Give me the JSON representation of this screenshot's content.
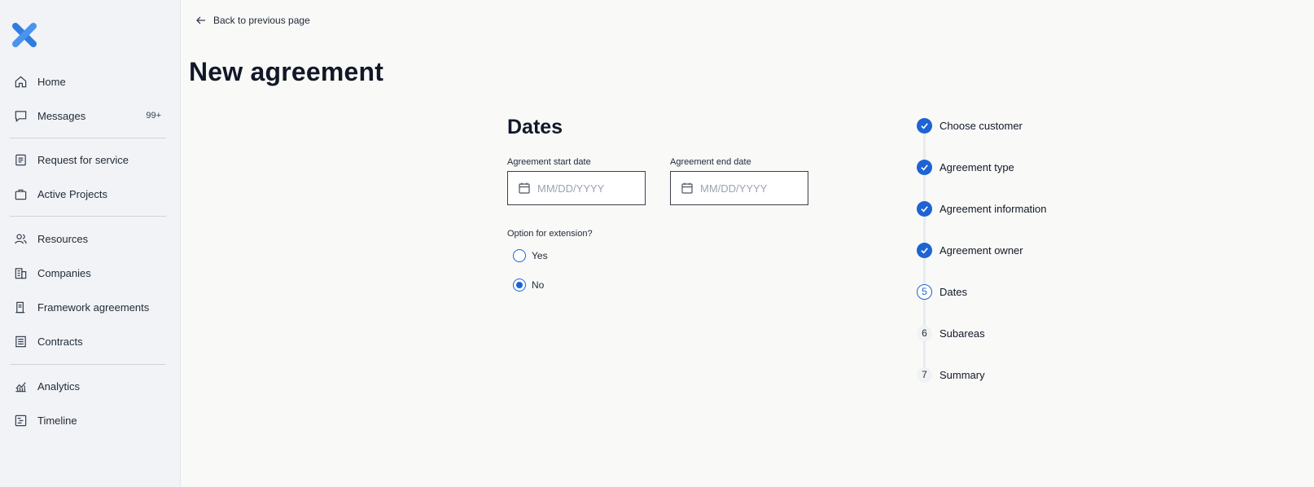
{
  "sidebar": {
    "items": [
      {
        "label": "Home",
        "icon": "home-icon"
      },
      {
        "label": "Messages",
        "icon": "chat-icon",
        "badge": "99+"
      },
      {
        "label": "Request for service",
        "icon": "list-document-icon"
      },
      {
        "label": "Active Projects",
        "icon": "briefcase-icon"
      },
      {
        "label": "Resources",
        "icon": "people-icon"
      },
      {
        "label": "Companies",
        "icon": "building-icon"
      },
      {
        "label": "Framework agreements",
        "icon": "document-icon"
      },
      {
        "label": "Contracts",
        "icon": "list-icon"
      },
      {
        "label": "Analytics",
        "icon": "chart-icon"
      },
      {
        "label": "Timeline",
        "icon": "timeline-icon"
      }
    ]
  },
  "header": {
    "back_label": "Back to previous page",
    "title": "New agreement"
  },
  "form": {
    "section_title": "Dates",
    "start_date": {
      "label": "Agreement start date",
      "placeholder": "MM/DD/YYYY",
      "value": ""
    },
    "end_date": {
      "label": "Agreement end date",
      "placeholder": "MM/DD/YYYY",
      "value": ""
    },
    "extension": {
      "label": "Option for extension?",
      "options": [
        "Yes",
        "No"
      ],
      "selected": "No"
    }
  },
  "stepper": {
    "steps": [
      {
        "number": "1",
        "label": "Choose customer",
        "status": "done"
      },
      {
        "number": "2",
        "label": "Agreement type",
        "status": "done"
      },
      {
        "number": "3",
        "label": "Agreement information",
        "status": "done"
      },
      {
        "number": "4",
        "label": "Agreement owner",
        "status": "done"
      },
      {
        "number": "5",
        "label": "Dates",
        "status": "current"
      },
      {
        "number": "6",
        "label": "Subareas",
        "status": "todo"
      },
      {
        "number": "7",
        "label": "Summary",
        "status": "todo"
      }
    ]
  },
  "colors": {
    "accent": "#1e63d3",
    "sidebar_bg": "#f1f3f6",
    "page_bg": "#f9f9f8"
  }
}
